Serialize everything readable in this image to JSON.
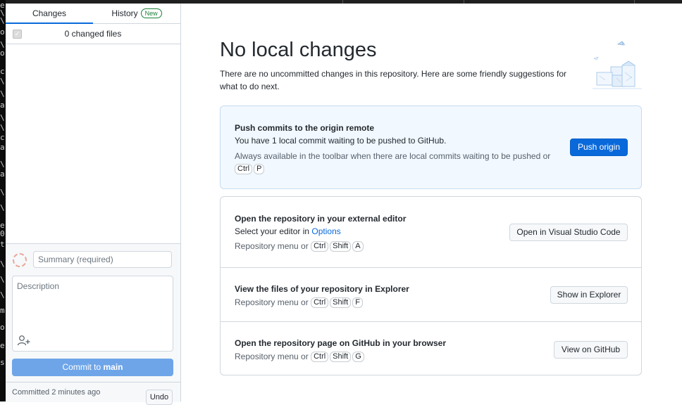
{
  "tabs": [
    {
      "label": "Changes",
      "active": true
    },
    {
      "label": "History",
      "badge": "New"
    }
  ],
  "changes": {
    "count_label": "0 changed files"
  },
  "commit": {
    "summary_placeholder": "Summary (required)",
    "description_placeholder": "Description",
    "button_prefix": "Commit to ",
    "branch": "main"
  },
  "last_commit": {
    "label": "Committed 2 minutes ago",
    "undo_label": "Undo"
  },
  "main": {
    "title": "No local changes",
    "subtitle": "There are no uncommitted changes in this repository. Here are some friendly suggestions for what to do next."
  },
  "suggestions": {
    "push": {
      "title": "Push commits to the origin remote",
      "desc": "You have 1 local commit waiting to be pushed to GitHub.",
      "hint": "Always available in the toolbar when there are local commits waiting to be pushed or",
      "keys": [
        "Ctrl",
        "P"
      ],
      "button": "Push origin"
    },
    "editor": {
      "title": "Open the repository in your external editor",
      "desc_prefix": "Select your editor in ",
      "desc_link": "Options",
      "hint_prefix": "Repository menu or",
      "keys": [
        "Ctrl",
        "Shift",
        "A"
      ],
      "button": "Open in Visual Studio Code"
    },
    "explorer": {
      "title": "View the files of your repository in Explorer",
      "hint_prefix": "Repository menu or",
      "keys": [
        "Ctrl",
        "Shift",
        "F"
      ],
      "button": "Show in Explorer"
    },
    "github": {
      "title": "Open the repository page on GitHub in your browser",
      "hint_prefix": "Repository menu or",
      "keys": [
        "Ctrl",
        "Shift",
        "G"
      ],
      "button": "View on GitHub"
    }
  },
  "colors": {
    "accent": "#0969da",
    "commit_button": "#6ea5e8",
    "highlight_bg": "#f1f8ff"
  }
}
